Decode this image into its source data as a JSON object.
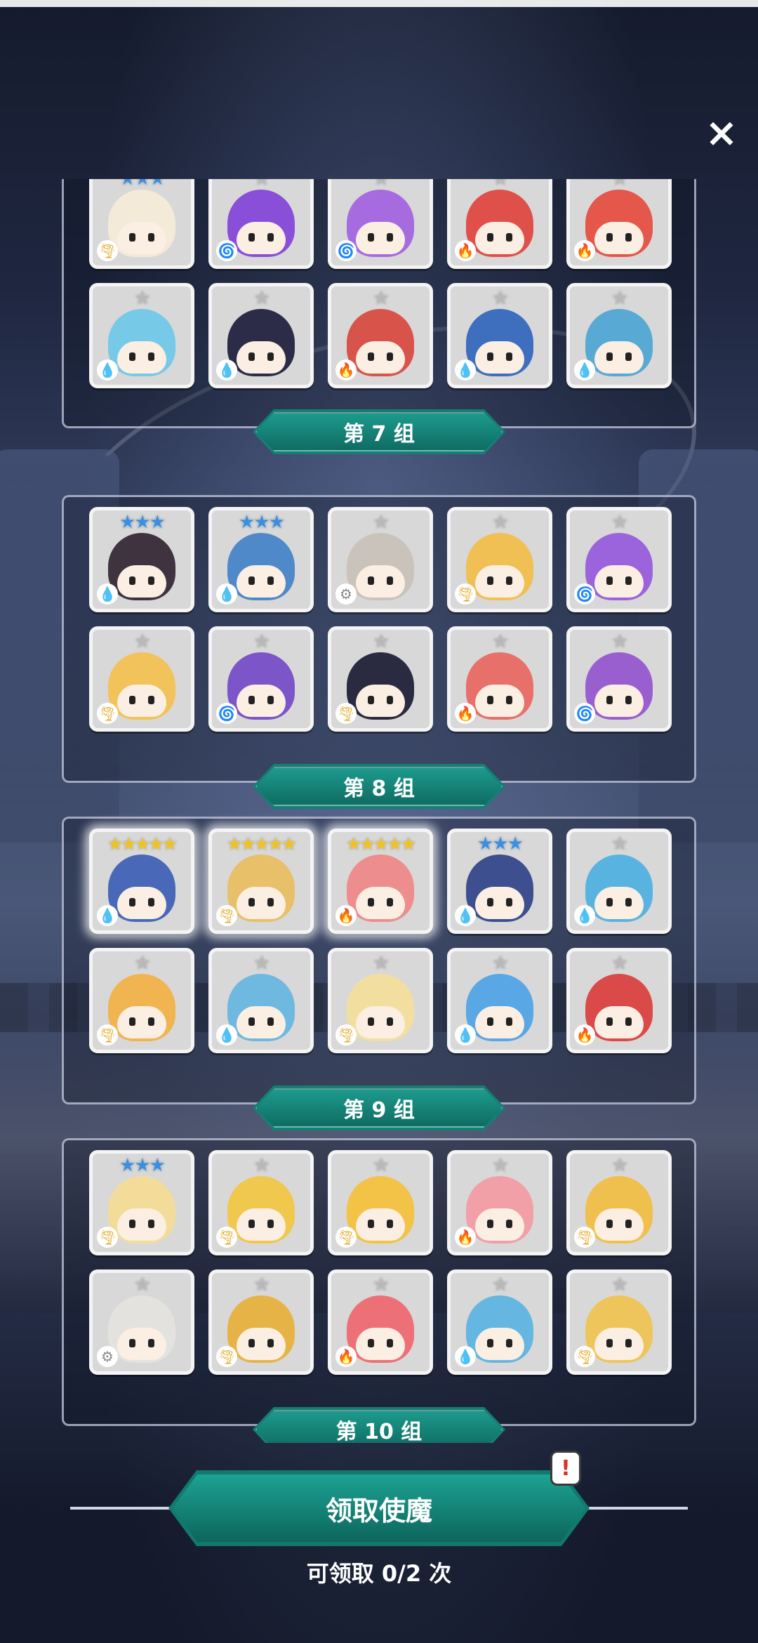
{
  "close_icon": "×",
  "groups": [
    {
      "label": "第 7 组",
      "cards": [
        {
          "stars": "★★★",
          "tier": "s3",
          "element": "wind",
          "color": "#f3ead8"
        },
        {
          "stars": "★",
          "tier": "s1",
          "element": "dark",
          "color": "#8a4fd8"
        },
        {
          "stars": "★",
          "tier": "s1",
          "element": "dark",
          "color": "#a76be0"
        },
        {
          "stars": "★",
          "tier": "s1",
          "element": "fire",
          "color": "#e0504a"
        },
        {
          "stars": "★",
          "tier": "s1",
          "element": "fire",
          "color": "#e4574a"
        },
        {
          "stars": "★",
          "tier": "s1",
          "element": "water",
          "color": "#77c9e8"
        },
        {
          "stars": "★",
          "tier": "s1",
          "element": "water",
          "color": "#2c2c48"
        },
        {
          "stars": "★",
          "tier": "s1",
          "element": "fire",
          "color": "#d8544a"
        },
        {
          "stars": "★",
          "tier": "s1",
          "element": "water",
          "color": "#3e6fbf"
        },
        {
          "stars": "★",
          "tier": "s1",
          "element": "water",
          "color": "#58a9d4"
        }
      ]
    },
    {
      "label": "第 8 组",
      "cards": [
        {
          "stars": "★★★",
          "tier": "s3",
          "element": "water",
          "color": "#3f3340"
        },
        {
          "stars": "★★★",
          "tier": "s3",
          "element": "water",
          "color": "#4f89c9"
        },
        {
          "stars": "★",
          "tier": "s1",
          "element": "light",
          "color": "#c9c3bc"
        },
        {
          "stars": "★",
          "tier": "s1",
          "element": "wind",
          "color": "#f0c055"
        },
        {
          "stars": "★",
          "tier": "s1",
          "element": "dark",
          "color": "#9b64dd"
        },
        {
          "stars": "★",
          "tier": "s1",
          "element": "wind",
          "color": "#f2c35a"
        },
        {
          "stars": "★",
          "tier": "s1",
          "element": "dark",
          "color": "#7c55c8"
        },
        {
          "stars": "★",
          "tier": "s1",
          "element": "wind",
          "color": "#2a2a40"
        },
        {
          "stars": "★",
          "tier": "s1",
          "element": "fire",
          "color": "#e8706a"
        },
        {
          "stars": "★",
          "tier": "s1",
          "element": "dark",
          "color": "#9a5fcf"
        }
      ]
    },
    {
      "label": "第 9 组",
      "cards": [
        {
          "stars": "★★★★★",
          "tier": "s5",
          "element": "water",
          "color": "#4a68b8",
          "glow": true
        },
        {
          "stars": "★★★★★",
          "tier": "s5",
          "element": "wind",
          "color": "#e8c06a",
          "glow": true
        },
        {
          "stars": "★★★★★",
          "tier": "s5",
          "element": "fire",
          "color": "#ee8d8d",
          "glow": true
        },
        {
          "stars": "★★★",
          "tier": "s3",
          "element": "water",
          "color": "#3d4f8f"
        },
        {
          "stars": "★",
          "tier": "s1",
          "element": "water",
          "color": "#59b3e0"
        },
        {
          "stars": "★",
          "tier": "s1",
          "element": "wind",
          "color": "#f0b450"
        },
        {
          "stars": "★",
          "tier": "s1",
          "element": "water",
          "color": "#6fb8df"
        },
        {
          "stars": "★",
          "tier": "s1",
          "element": "wind",
          "color": "#f2dfa0"
        },
        {
          "stars": "★",
          "tier": "s1",
          "element": "water",
          "color": "#5aa7e5"
        },
        {
          "stars": "★",
          "tier": "s1",
          "element": "fire",
          "color": "#d94a48"
        }
      ]
    },
    {
      "label": "第 10 组",
      "cards": [
        {
          "stars": "★★★",
          "tier": "s3",
          "element": "wind",
          "color": "#f3dc9a"
        },
        {
          "stars": "★",
          "tier": "s1",
          "element": "wind",
          "color": "#f0c84e"
        },
        {
          "stars": "★",
          "tier": "s1",
          "element": "wind",
          "color": "#f2c346"
        },
        {
          "stars": "★",
          "tier": "s1",
          "element": "fire",
          "color": "#f1a0a8"
        },
        {
          "stars": "★",
          "tier": "s1",
          "element": "wind",
          "color": "#f0c04f"
        },
        {
          "stars": "★",
          "tier": "s1",
          "element": "light",
          "color": "#e4e2de"
        },
        {
          "stars": "★",
          "tier": "s1",
          "element": "wind",
          "color": "#e6b446"
        },
        {
          "stars": "★",
          "tier": "s1",
          "element": "fire",
          "color": "#ee7077"
        },
        {
          "stars": "★",
          "tier": "s1",
          "element": "water",
          "color": "#66b6e2"
        },
        {
          "stars": "★",
          "tier": "s1",
          "element": "wind",
          "color": "#eec55a"
        }
      ]
    }
  ],
  "element_icons": {
    "water": "💧",
    "fire": "🔥",
    "wind": "🌪",
    "dark": "🌀",
    "light": "⚙"
  },
  "claim_button": {
    "label": "领取使魔"
  },
  "alert_badge": "!",
  "claim_count": "可领取 0/2 次"
}
